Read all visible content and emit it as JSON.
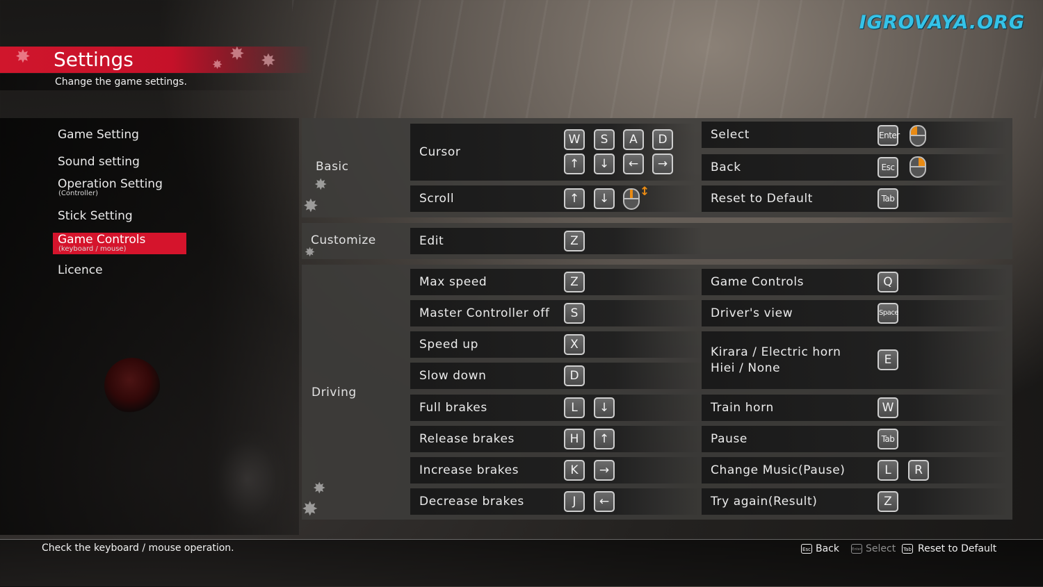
{
  "watermark": "IGROVAYA.ORG",
  "header": {
    "title": "Settings",
    "subtitle": "Change the game settings."
  },
  "menu": {
    "game_setting": "Game Setting",
    "sound_setting": "Sound setting",
    "operation_setting": "Operation Setting",
    "operation_setting_sub": "(Controller)",
    "stick_setting": "Stick Setting",
    "game_controls": "Game Controls",
    "game_controls_sub": "(keyboard / mouse)",
    "licence": "Licence"
  },
  "sections": {
    "basic": "Basic",
    "customize": "Customize",
    "driving": "Driving"
  },
  "basic": {
    "cursor": {
      "label": "Cursor",
      "keys": [
        "W",
        "S",
        "A",
        "D"
      ],
      "arrows": [
        "↑",
        "↓",
        "←",
        "→"
      ]
    },
    "scroll": {
      "label": "Scroll",
      "keys": [
        "↑",
        "↓"
      ],
      "mouse_icon": "mouse-wheel-icon",
      "arrow": "↕"
    },
    "select": {
      "label": "Select",
      "key": "Enter",
      "mouse_icon": "mouse-left-click-icon"
    },
    "back": {
      "label": "Back",
      "key": "Esc",
      "mouse_icon": "mouse-right-click-icon"
    },
    "reset": {
      "label": "Reset to Default",
      "key": "Tab"
    }
  },
  "customize": {
    "edit": {
      "label": "Edit",
      "key": "Z"
    }
  },
  "driving": {
    "left": [
      {
        "label": "Max speed",
        "keys": [
          "Z"
        ]
      },
      {
        "label": "Master Controller off",
        "keys": [
          "S"
        ]
      },
      {
        "label": "Speed up",
        "keys": [
          "X"
        ]
      },
      {
        "label": "Slow down",
        "keys": [
          "D"
        ]
      },
      {
        "label": "Full brakes",
        "keys": [
          "L",
          "↓"
        ]
      },
      {
        "label": "Release brakes",
        "keys": [
          "H",
          "↑"
        ]
      },
      {
        "label": "Increase brakes",
        "keys": [
          "K",
          "→"
        ]
      },
      {
        "label": "Decrease brakes",
        "keys": [
          "J",
          "←"
        ]
      }
    ],
    "right": [
      {
        "label": "Game Controls",
        "keys": [
          "Q"
        ]
      },
      {
        "label": "Driver's view",
        "keys": [
          "Space"
        ]
      },
      {
        "label_line1": "Kirara / Electric horn",
        "label_line2": "Hiei / None",
        "keys": [
          "E"
        ]
      },
      {
        "label": "Train horn",
        "keys": [
          "W"
        ]
      },
      {
        "label": "Pause",
        "keys": [
          "Tab"
        ]
      },
      {
        "label": "Change Music(Pause)",
        "keys": [
          "L",
          "R"
        ]
      },
      {
        "label": "Try again(Result)",
        "keys": [
          "Z"
        ]
      }
    ]
  },
  "footer": {
    "hint": "Check the keyboard / mouse operation.",
    "back": {
      "key": "Esc",
      "label": "Back"
    },
    "select": {
      "key": "Enter",
      "label": "Select"
    },
    "reset": {
      "key": "Tab",
      "label": "Reset to Default"
    }
  },
  "colors": {
    "accent_red": "#d5142c",
    "mouse_orange": "#e98b14",
    "watermark_cyan": "#35c3e8"
  }
}
